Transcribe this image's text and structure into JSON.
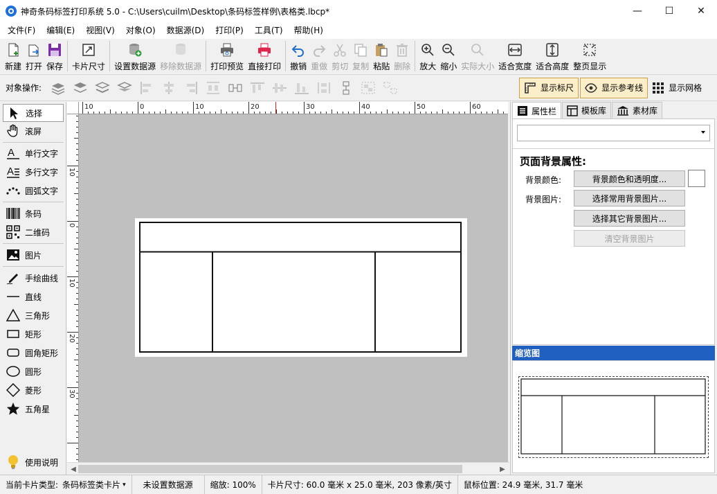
{
  "window": {
    "title": "神奇条码标签打印系统 5.0 - C:\\Users\\cuilm\\Desktop\\条码标签样例\\表格类.lbcp*",
    "minimize_label": "—",
    "maximize_label": "☐",
    "close_label": "✕"
  },
  "menu": [
    "文件(F)",
    "编辑(E)",
    "视图(V)",
    "对象(O)",
    "数据源(D)",
    "打印(P)",
    "工具(T)",
    "帮助(H)"
  ],
  "toolbar": {
    "new": "新建",
    "open": "打开",
    "save": "保存",
    "card_size": "卡片尺寸",
    "set_datasource": "设置数据源",
    "remove_datasource": "移除数据源",
    "print_preview": "打印预览",
    "direct_print": "直接打印",
    "undo": "撤销",
    "redo": "重做",
    "cut": "剪切",
    "copy": "复制",
    "paste": "粘贴",
    "delete": "删除",
    "zoom_in": "放大",
    "zoom_out": "缩小",
    "actual_size": "实际大小",
    "fit_width": "适合宽度",
    "fit_height": "适合高度",
    "fit_page": "整页显示"
  },
  "object_bar": {
    "label": "对象操作:",
    "show_ruler": "显示标尺",
    "show_guides": "显示参考线",
    "show_grid": "显示网格"
  },
  "tools": {
    "select": "选择",
    "scroll": "滚屏",
    "single_text": "单行文字",
    "multi_text": "多行文字",
    "arc_text": "圆弧文字",
    "barcode": "条码",
    "qrcode": "二维码",
    "image": "图片",
    "freehand": "手绘曲线",
    "line": "直线",
    "triangle": "三角形",
    "rectangle": "矩形",
    "rounded_rect": "圆角矩形",
    "circle": "圆形",
    "diamond": "菱形",
    "star": "五角星",
    "help": "使用说明"
  },
  "ruler": {
    "top_labels": [
      "10",
      "0",
      "10",
      "20",
      "30",
      "40",
      "50",
      "60"
    ],
    "left_labels": [
      "10",
      "0",
      "10",
      "20",
      "30"
    ]
  },
  "right_panel": {
    "tabs": [
      "属性栏",
      "模板库",
      "素材库"
    ],
    "prop_title": "页面背景属性:",
    "bg_color_label": "背景颜色:",
    "bg_color_button": "背景颜色和透明度...",
    "bg_image_label": "背景图片:",
    "choose_common_bg": "选择常用背景图片...",
    "choose_other_bg": "选择其它背景图片...",
    "clear_bg": "清空背景图片",
    "preview_title": "缩览图"
  },
  "status": {
    "card_type": "当前卡片类型:",
    "card_type_value": "条码标签类卡片",
    "datasource": "未设置数据源",
    "zoom": "缩放: 100%",
    "card_size": "卡片尺寸: 60.0 毫米 x 25.0 毫米, 203 像素/英寸",
    "mouse_pos": "鼠标位置: 24.9 毫米, 31.7 毫米"
  },
  "colors": {
    "preview_header": "#1f5fc0",
    "canvas_bg": "#c0c0c0",
    "toggle_active": "#fbeec8",
    "print_icon": "#e0264b",
    "save_icon": "#7b2fa8"
  }
}
